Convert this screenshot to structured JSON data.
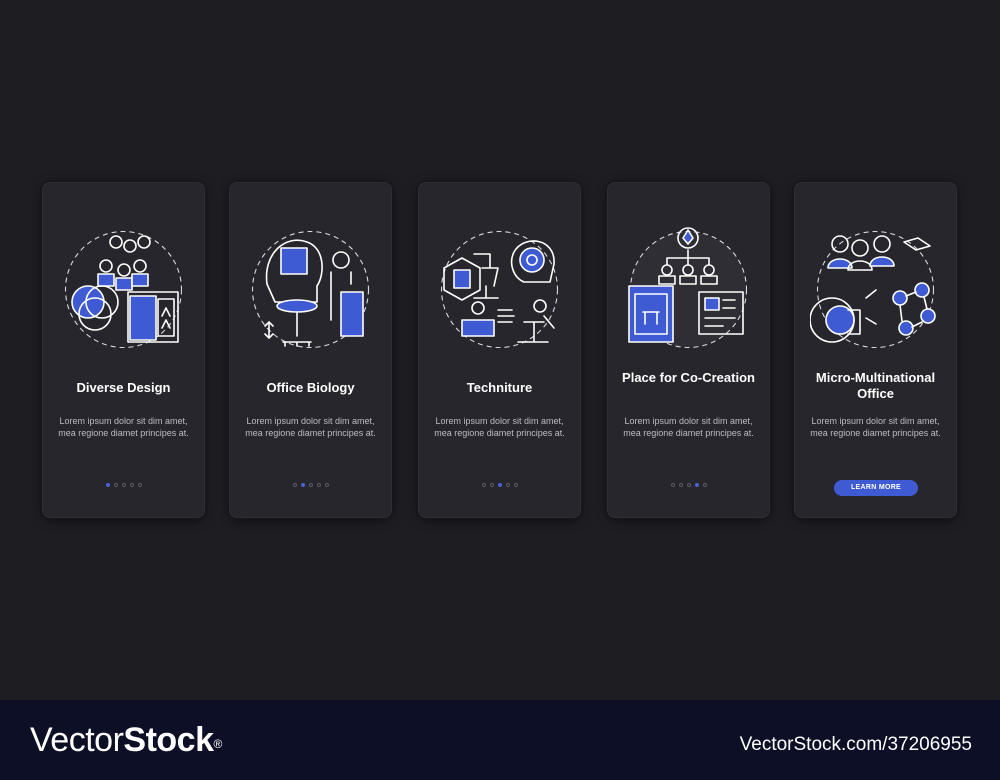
{
  "cards": [
    {
      "title": "Diverse Design",
      "description": "Lorem ipsum dolor sit dim amet, mea regione diamet principes at.",
      "active_dot": 0
    },
    {
      "title": "Office Biology",
      "description": "Lorem ipsum dolor sit dim amet, mea regione diamet principes at.",
      "active_dot": 1
    },
    {
      "title": "Techniture",
      "description": "Lorem ipsum dolor sit dim amet, mea regione diamet principes at.",
      "active_dot": 2
    },
    {
      "title": "Place for Co-Creation",
      "description": "Lorem ipsum dolor sit dim amet, mea regione diamet principes at.",
      "active_dot": 3
    },
    {
      "title": "Micro-Multinational Office",
      "description": "Lorem ipsum dolor sit dim amet, mea regione diamet principes at.",
      "button_label": "LEARN MORE"
    }
  ],
  "colors": {
    "accent": "#3f5bd4",
    "background": "#1e1d22",
    "card": "#27262c",
    "footer": "#0c0f26"
  },
  "footer": {
    "brand_regular": "Vector",
    "brand_bold": "Stock",
    "brand_mark": "®",
    "image_id": "VectorStock.com/37206955"
  }
}
